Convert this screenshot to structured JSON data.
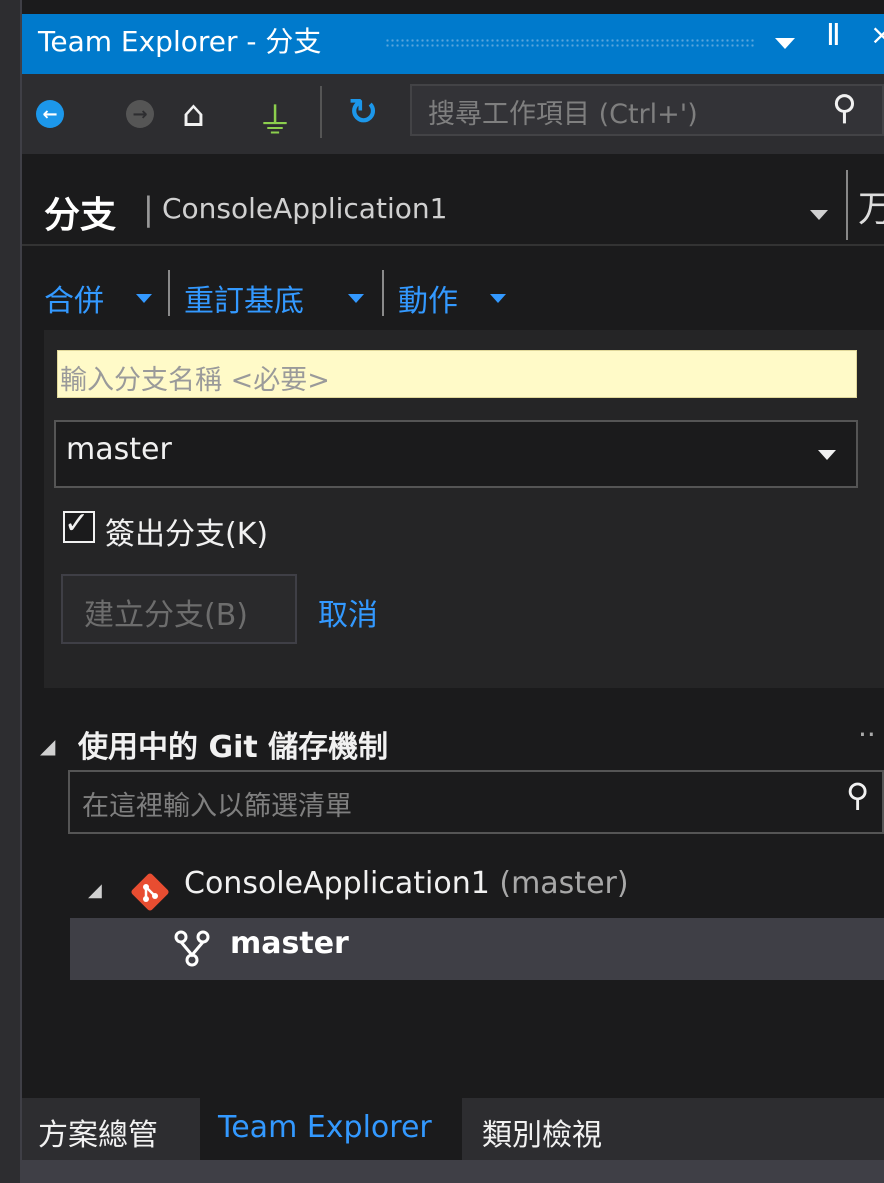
{
  "window": {
    "title": "Team Explorer - 分支",
    "pin_glyph": "Ⅱ",
    "close_glyph": "×"
  },
  "toolbar": {
    "search_placeholder": "搜尋工作項目 (Ctrl+')"
  },
  "header": {
    "title": "分支",
    "separator": "|",
    "subtitle": "ConsoleApplication1",
    "cut_text": "万"
  },
  "actions": [
    {
      "label": "合併"
    },
    {
      "label": "重訂基底"
    },
    {
      "label": "動作"
    }
  ],
  "create_branch": {
    "name_placeholder": "輸入分支名稱 <必要>",
    "base_branch": "master",
    "checkout_label": "簽出分支(K)",
    "checkout_checked": true,
    "create_button": "建立分支(B)",
    "cancel_link": "取消"
  },
  "repos": {
    "section_title": "使用中的 Git 儲存機制",
    "more": "··",
    "filter_placeholder": "在這裡輸入以篩選清單",
    "repo_name": "ConsoleApplication1",
    "repo_branch": "(master)",
    "branches": [
      "master"
    ]
  },
  "tabs": [
    {
      "label": "方案總管",
      "active": false
    },
    {
      "label": "Team Explorer",
      "active": true
    },
    {
      "label": "類別檢視",
      "active": false
    }
  ],
  "colors": {
    "accent": "#007acc",
    "link": "#3399ff",
    "input_highlight": "#fffac8",
    "git_logo": "#e84d31"
  }
}
